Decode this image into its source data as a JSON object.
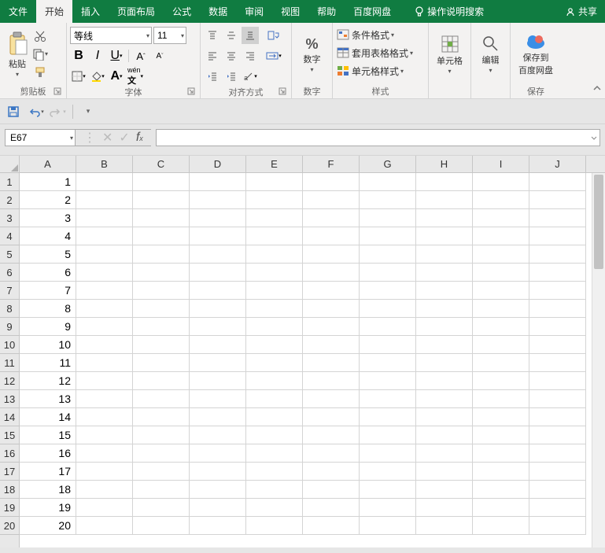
{
  "tabs": {
    "file": "文件",
    "home": "开始",
    "insert": "插入",
    "layout": "页面布局",
    "formula": "公式",
    "data": "数据",
    "review": "审阅",
    "view": "视图",
    "help": "帮助",
    "baidu": "百度网盘",
    "search": "操作说明搜索",
    "share": "共享"
  },
  "groups": {
    "clipboard": {
      "label": "剪贴板",
      "paste": "粘贴"
    },
    "font": {
      "label": "字体",
      "name": "等线",
      "size": "11"
    },
    "align": {
      "label": "对齐方式"
    },
    "number": {
      "label": "数字",
      "btn": "数字"
    },
    "styles": {
      "label": "样式",
      "cond": "条件格式",
      "tablefmt": "套用表格格式",
      "cellfmt": "单元格样式"
    },
    "cells": {
      "label": "单元格",
      "btn": "单元格"
    },
    "editing": {
      "label": "编辑",
      "btn": "编辑"
    },
    "save": {
      "label": "保存",
      "btn1": "保存到",
      "btn2": "百度网盘"
    }
  },
  "namebox": "E67",
  "columns": [
    "A",
    "B",
    "C",
    "D",
    "E",
    "F",
    "G",
    "H",
    "I",
    "J"
  ],
  "rows": [
    1,
    2,
    3,
    4,
    5,
    6,
    7,
    8,
    9,
    10,
    11,
    12,
    13,
    14,
    15,
    16,
    17,
    18,
    19,
    20
  ],
  "cellsA": [
    "1",
    "2",
    "3",
    "4",
    "5",
    "6",
    "7",
    "8",
    "9",
    "10",
    "11",
    "12",
    "13",
    "14",
    "15",
    "16",
    "17",
    "18",
    "19",
    "20"
  ]
}
